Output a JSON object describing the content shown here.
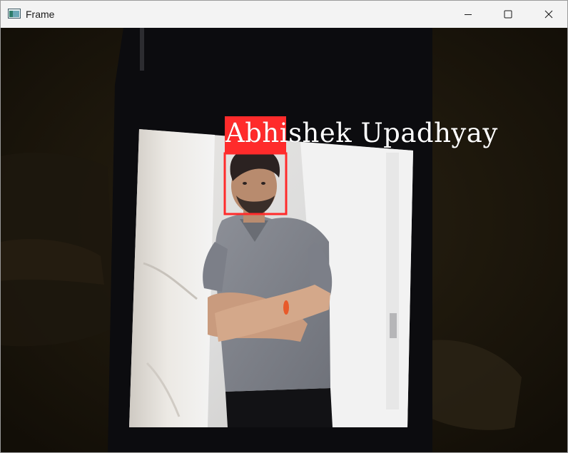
{
  "window": {
    "title": "Frame",
    "minimize_glyph": "—",
    "maximize_glyph": "□",
    "close_glyph": "✕"
  },
  "detection": {
    "name_label": "Abhishek Upadhyay",
    "box_color": "#ff2b2b"
  },
  "icons": {
    "app": "window-frame-icon",
    "minimize": "minimize-icon",
    "maximize": "maximize-icon",
    "close": "close-icon"
  }
}
